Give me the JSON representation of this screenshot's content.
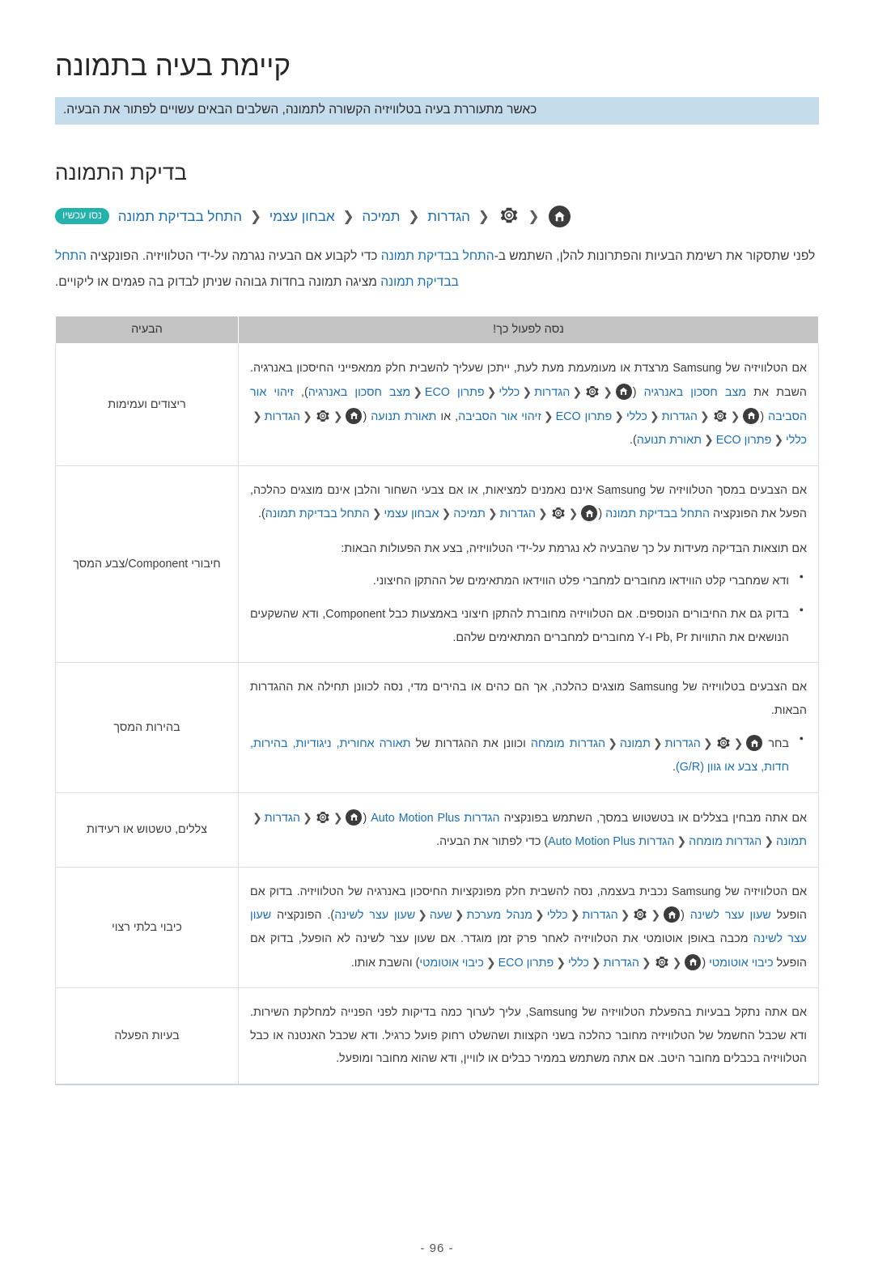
{
  "page": {
    "title": "קיימת בעיה בתמונה",
    "subtitle": "כאשר מתעוררת בעיה בטלוויזיה הקשורה לתמונה, השלבים הבאים עשויים לפתור את הבעיה.",
    "section_heading": "בדיקת התמונה",
    "page_number": "- 96 -"
  },
  "breadcrumb": {
    "items": [
      "הגדרות",
      "תמיכה",
      "אבחון עצמי",
      "התחל בבדיקת תמונה"
    ],
    "separator": "❮",
    "badge": "נסו עכשיו",
    "home_icon": "home-icon",
    "gear_icon": "gear-icon"
  },
  "intro": {
    "line1_a": "לפני שתסקור את רשימת הבעיות והפתרונות להלן, השתמש ב-",
    "line1_link": "התחל בבדיקת תמונה",
    "line1_b": " כדי לקבוע אם הבעיה נגרמה על-ידי הטלוויזיה.",
    "line2_link": "התחל בבדיקת תמונה",
    "line2_a": "הפונקציה ",
    "line2_b": " מציגה תמונה בחדות גבוהה שניתן לבדוק בה פגמים או ליקויים."
  },
  "table": {
    "header": {
      "problem": "הבעיה",
      "solution": "נסה לפעול כך!"
    },
    "rows": [
      {
        "problem": "ריצודים ועמימות",
        "p1_a": "אם הטלוויזיה של Samsung מרצדת או מעומעמת מעת לעת, ייתכן שעליך להשבית חלק ממאפייני החיסכון באנרגיה. השבת את ",
        "p1_link1": "מצב חסכון באנרגיה",
        "p1_mid1": " (",
        "path1": [
          "הגדרות",
          "כללי",
          "פתרון ECO",
          "מצב חסכון באנרגיה"
        ],
        "p1_mid2": "), ",
        "p1_link2": "זיהוי אור הסביבה",
        "path2": [
          "הגדרות",
          "כללי",
          "פתרון ECO",
          "זיהוי אור הסביבה"
        ],
        "p1_mid3": ", או ",
        "p1_link3": "תאורת תנועה",
        "path3": [
          "הגדרות",
          "כללי",
          "פתרון ECO",
          "תאורת תנועה"
        ],
        "p1_end": ")."
      },
      {
        "problem": "חיבורי Component/צבע המסך",
        "p1_a": "אם הצבעים במסך הטלוויזיה של Samsung אינם נאמנים למציאות, או אם צבעי השחור והלבן אינם מוצגים כהלכה, הפעל את הפונקציה ",
        "p1_link": "התחל בבדיקת תמונה",
        "p1_mid": " (",
        "path": [
          "הגדרות",
          "תמיכה",
          "אבחון עצמי",
          "התחל בבדיקת תמונה"
        ],
        "p1_end": ").",
        "p2": "אם תוצאות הבדיקה מעידות על כך שהבעיה לא נגרמת על-ידי הטלוויזיה, בצע את הפעולות הבאות:",
        "bullets": [
          "ודא שמחברי קלט הווידאו מחוברים למחברי פלט הווידאו המתאימים של ההתקן החיצוני.",
          "בדוק גם את החיבורים הנוספים. אם הטלוויזיה מחוברת להתקן חיצוני באמצעות כבל Component, ודא שהשקעים הנושאים את התוויות Pb, Pr ו-Y מחוברים למחברים המתאימים שלהם."
        ]
      },
      {
        "problem": "בהירות המסך",
        "p1": "אם הצבעים בטלוויזיה של Samsung מוצגים כהלכה, אך הם כהים או בהירים מדי, נסה לכוונן תחילה את ההגדרות הבאות.",
        "bullet_a": "בחר ",
        "path": [
          "הגדרות",
          "תמונה",
          "הגדרות מומחה"
        ],
        "bullet_b": " וכוונן את ההגדרות של ",
        "bullet_link": "תאורה אחורית, ניגודיות, בהירות, חדות, צבע או גוון (G/R)",
        "bullet_end": "."
      },
      {
        "problem": "צללים, טשטוש או רעידות",
        "p1_a": "אם אתה מבחין בצללים או בטשטוש במסך, השתמש בפונקציה ",
        "p1_link": "הגדרות Auto Motion Plus",
        "p1_mid": " (",
        "path": [
          "הגדרות",
          "תמונה",
          "הגדרות מומחה",
          "הגדרות Auto Motion Plus"
        ],
        "p1_end": ") כדי לפתור את הבעיה."
      },
      {
        "problem": "כיבוי בלתי רצוי",
        "p1_a": "אם הטלוויזיה של Samsung נכבית בעצמה, נסה להשבית חלק מפונקציות החיסכון באנרגיה של הטלוויזיה. בדוק אם הופעל ",
        "p1_link1": "שעון עצר לשינה",
        "path1": [
          "הגדרות",
          "כללי",
          "מנהל מערכת",
          "שעה",
          "שעון עצר לשינה"
        ],
        "p1_mid": "). הפונקציה ",
        "p1_link2": "שעון עצר לשינה",
        "p1_b": " מכבה באופן אוטומטי את הטלוויזיה לאחר פרק זמן מוגדר. אם שעון עצר לשינה לא הופעל, בדוק אם הופעל ",
        "p1_link3": "כיבוי אוטומטי",
        "path2": [
          "הגדרות",
          "כללי",
          "פתרון ECO",
          "כיבוי אוטומטי"
        ],
        "p1_end": ") והשבת אותו."
      },
      {
        "problem": "בעיות הפעלה",
        "p1": "אם אתה נתקל בבעיות בהפעלת הטלוויזיה של Samsung, עליך לערוך כמה בדיקות לפני הפנייה למחלקת השירות. ודא שכבל החשמל של הטלוויזיה מחובר כהלכה בשני הקצוות ושהשלט רחוק פועל כרגיל. ודא שכבל האנטנה או כבל הטלוויזיה בכבלים מחובר היטב. אם אתה משתמש בממיר כבלים או לוויין, ודא שהוא מחובר ומופעל."
      }
    ]
  },
  "colors": {
    "link": "#1a6fb5",
    "badge": "#23b3ac",
    "subtitle_bg": "#c5dced",
    "table_header_bg": "#c3c3c3",
    "icon_dark": "#3c3c3c"
  }
}
